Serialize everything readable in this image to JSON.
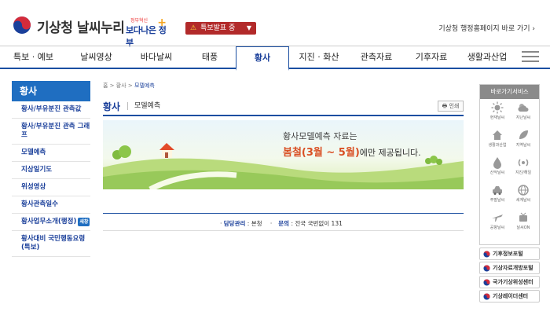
{
  "header": {
    "site_title": "기상청 날씨누리",
    "gov_badge": {
      "small": "정부혁신",
      "big": "보다나은 정부"
    },
    "alert_select": "특보발표 중",
    "kma_link": "기상청 행정홈페이지 바로 가기 ›"
  },
  "nav": {
    "items": [
      "특보 · 예보",
      "날씨영상",
      "바다날씨",
      "태풍",
      "황사",
      "지진 · 화산",
      "관측자료",
      "기후자료",
      "생활과산업"
    ],
    "active_index": 4
  },
  "sidebar": {
    "title": "황사",
    "items": [
      {
        "label": "황사/부유분진 관측값"
      },
      {
        "label": "황사/부유분진 관측 그래프"
      },
      {
        "label": "모델예측"
      },
      {
        "label": "지상일기도"
      },
      {
        "label": "위성영상"
      },
      {
        "label": "황사관측일수"
      },
      {
        "label": "황사업무소개(행정)",
        "tag": "새창"
      },
      {
        "label": "황사대비 국민행동요령(특보)"
      }
    ]
  },
  "content": {
    "breadcrumb": {
      "home": "홈",
      "section": "황사",
      "current": "모델예측"
    },
    "title": "황사",
    "subtitle": "모델예측",
    "print_label": "인쇄",
    "banner": {
      "line1": "황사모델예측 자료는",
      "emphasis": "봄철(3월 ~ 5월)",
      "line2_rest": "에만 제공됩니다."
    },
    "footer": {
      "manager_label": "담당관리",
      "manager_value": "본청",
      "contact_label": "문의",
      "contact_value": "전국 국번없이 131"
    }
  },
  "quick": {
    "title": "바로가기서비스",
    "items": [
      {
        "label": "현재날씨",
        "icon": "sun-icon"
      },
      {
        "label": "지난날씨",
        "icon": "cloud-sun-icon"
      },
      {
        "label": "생활과산업",
        "icon": "house-icon"
      },
      {
        "label": "지역날씨",
        "icon": "leaf-icon"
      },
      {
        "label": "산악날씨",
        "icon": "drop-icon"
      },
      {
        "label": "지진/해일",
        "icon": "signal-icon"
      },
      {
        "label": "주말날씨",
        "icon": "car-icon"
      },
      {
        "label": "세계날씨",
        "icon": "globe-icon"
      },
      {
        "label": "공항날씨",
        "icon": "plane-icon"
      },
      {
        "label": "날씨ON",
        "icon": "broadcast-icon"
      }
    ]
  },
  "portal_links": [
    "기후정보포털",
    "기상자료개방포털",
    "국가기상위성센터",
    "기상레이더센터"
  ],
  "colors": {
    "primary": "#1a4ea1",
    "sidebar_header": "#1f6ec1",
    "alert": "#b22a2a",
    "emphasis": "#d94f24"
  }
}
